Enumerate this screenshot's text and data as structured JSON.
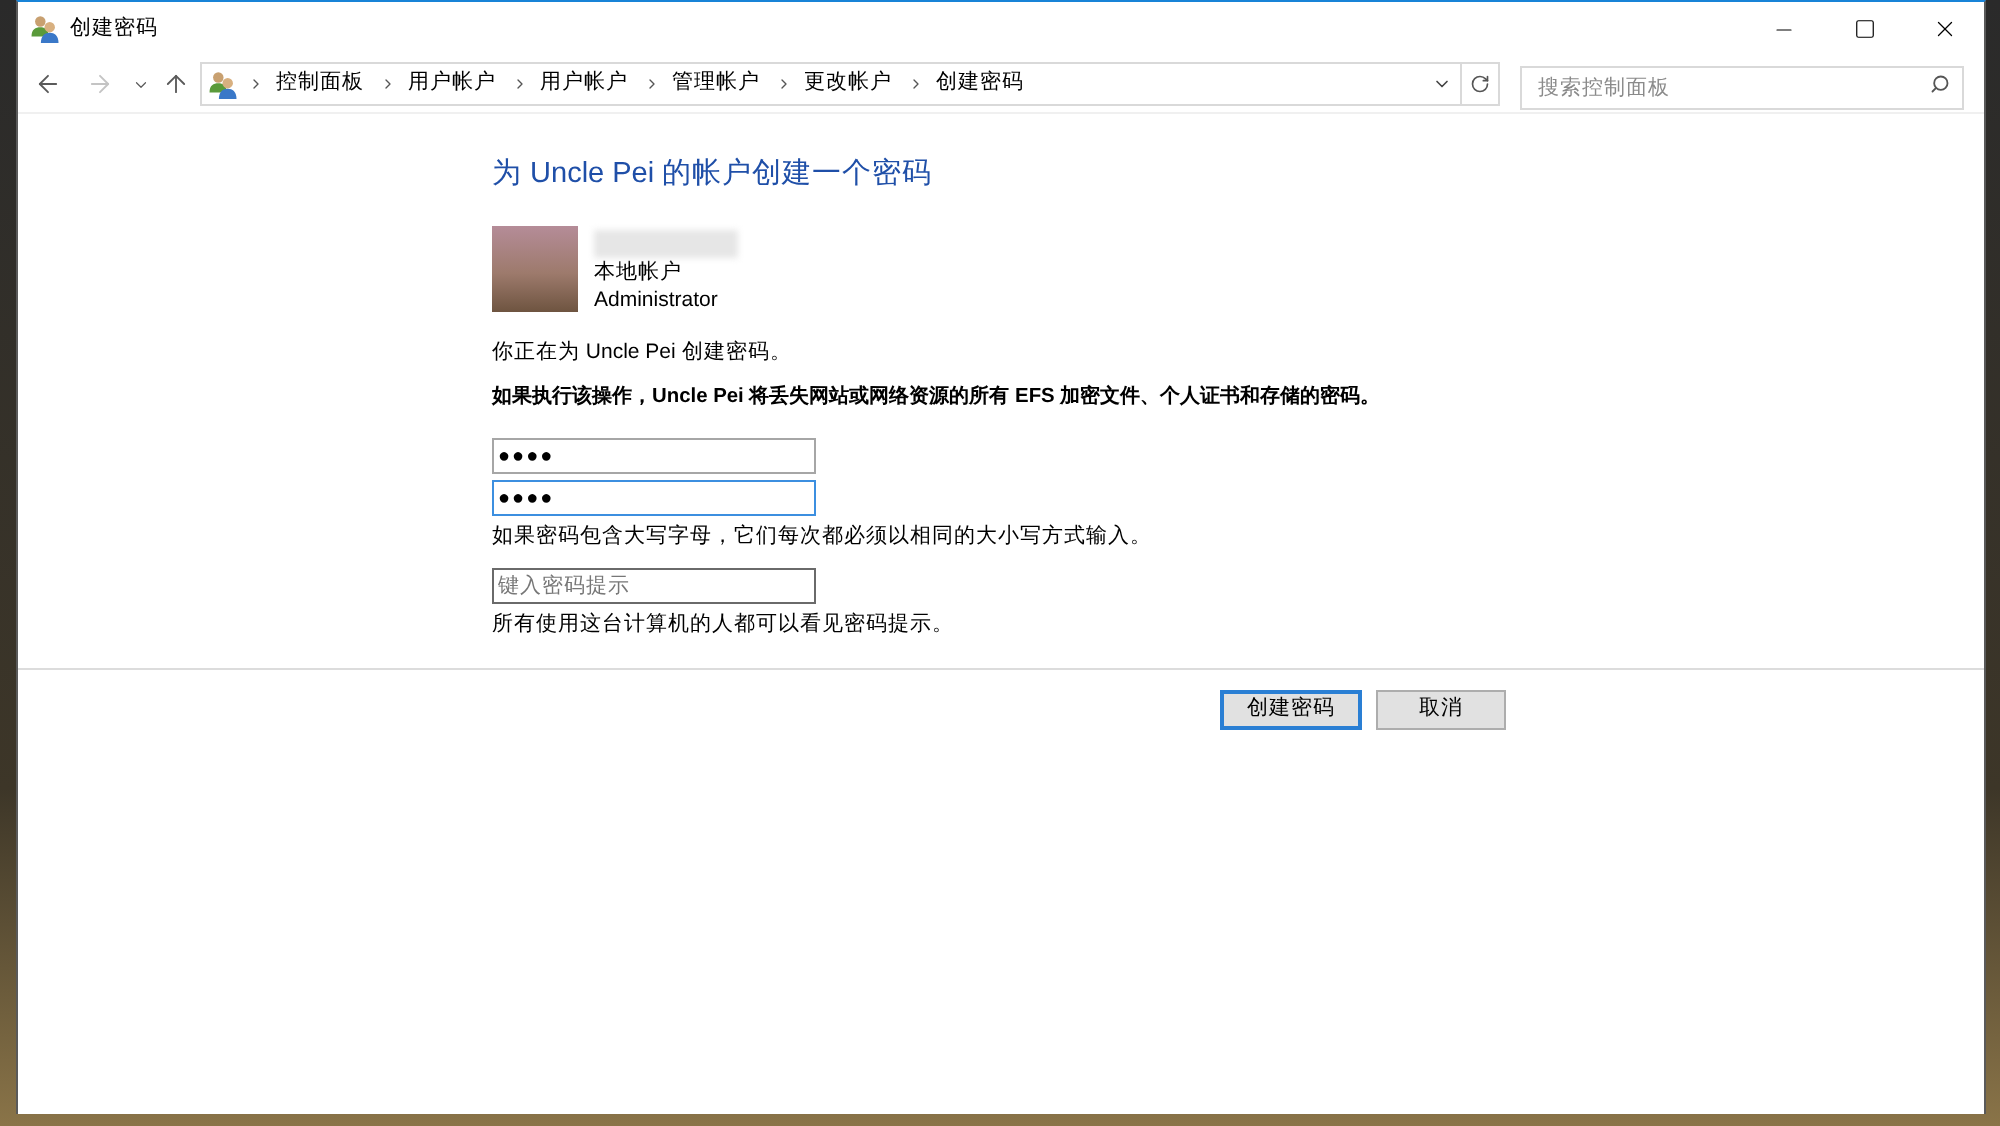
{
  "window": {
    "title": "创建密码"
  },
  "nav_buttons": [
    {
      "kind": "back",
      "disabled": false
    },
    {
      "kind": "forward",
      "disabled": true
    },
    {
      "kind": "recent",
      "disabled": false
    },
    {
      "kind": "up",
      "disabled": false
    }
  ],
  "address_bar": {
    "breadcrumbs": [
      "控制面板",
      "用户帐户",
      "用户帐户",
      "管理帐户",
      "更改帐户",
      "创建密码"
    ]
  },
  "search": {
    "placeholder": "搜索控制面板"
  },
  "heading": "为 Uncle Pei 的帐户创建一个密码",
  "account": {
    "type": "本地帐户",
    "role": "Administrator"
  },
  "intro": "你正在为 Uncle Pei 创建密码。",
  "warning": "如果执行该操作，Uncle Pei 将丢失网站或网络资源的所有 EFS 加密文件、个人证书和存储的密码。",
  "password_fields": [
    {
      "value": "●●●●",
      "focused": false
    },
    {
      "value": "●●●●",
      "focused": true
    }
  ],
  "case_note": "如果密码包含大写字母，它们每次都必须以相同的大小写方式输入。",
  "hint_field": {
    "placeholder": "键入密码提示"
  },
  "hint_note": "所有使用这台计算机的人都可以看见密码提示。",
  "buttons": [
    {
      "label": "创建密码",
      "default": true
    },
    {
      "label": "取消",
      "default": false
    }
  ]
}
